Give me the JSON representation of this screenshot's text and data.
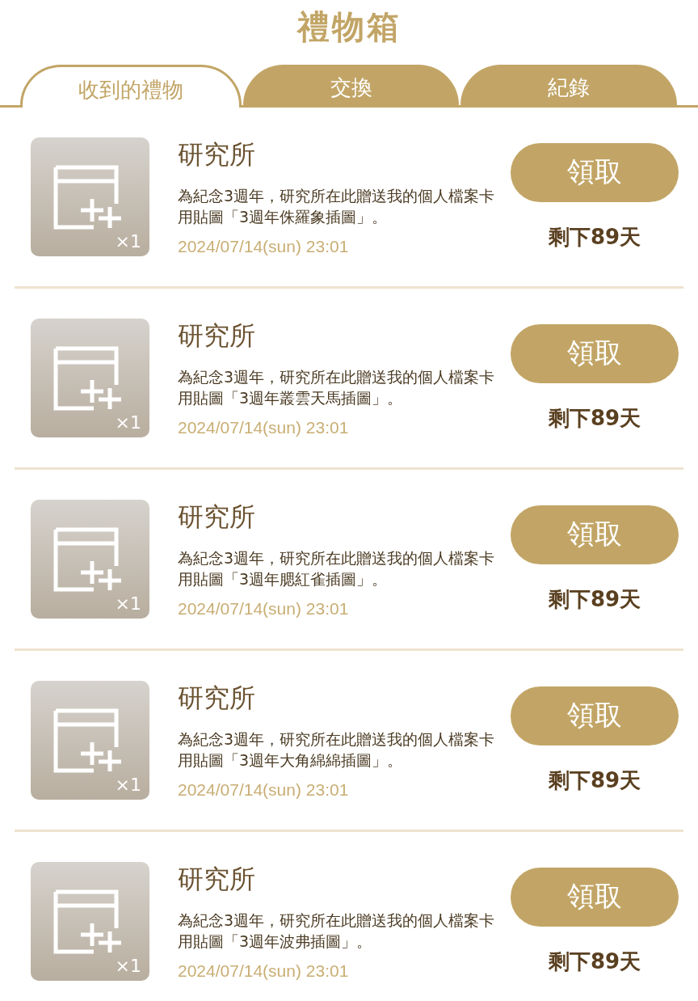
{
  "title": "禮物箱",
  "tabs": [
    {
      "label": "收到的禮物",
      "selected": true
    },
    {
      "label": "交換",
      "selected": false
    },
    {
      "label": "紀錄",
      "selected": false
    }
  ],
  "gifts": [
    {
      "sender": "研究所",
      "message": "為紀念3週年，研究所在此贈送我的個人檔案卡用貼圖「3週年侏羅象插圖」。",
      "quantity": "×1",
      "date": "2024/07/14(sun) 23:01",
      "button": "領取",
      "remaining": "剩下89天"
    },
    {
      "sender": "研究所",
      "message": "為紀念3週年，研究所在此贈送我的個人檔案卡用貼圖「3週年叢雲天馬插圖」。",
      "quantity": "×1",
      "date": "2024/07/14(sun) 23:01",
      "button": "領取",
      "remaining": "剩下89天"
    },
    {
      "sender": "研究所",
      "message": "為紀念3週年，研究所在此贈送我的個人檔案卡用貼圖「3週年腮紅雀插圖」。",
      "quantity": "×1",
      "date": "2024/07/14(sun) 23:01",
      "button": "領取",
      "remaining": "剩下89天"
    },
    {
      "sender": "研究所",
      "message": "為紀念3週年，研究所在此贈送我的個人檔案卡用貼圖「3週年大角綿綿插圖」。",
      "quantity": "×1",
      "date": "2024/07/14(sun) 23:01",
      "button": "領取",
      "remaining": "剩下89天"
    },
    {
      "sender": "研究所",
      "message": "為紀念3週年，研究所在此贈送我的個人檔案卡用貼圖「3週年波弗插圖」。",
      "quantity": "×1",
      "date": "2024/07/14(sun) 23:01",
      "button": "領取",
      "remaining": "剩下89天"
    }
  ]
}
